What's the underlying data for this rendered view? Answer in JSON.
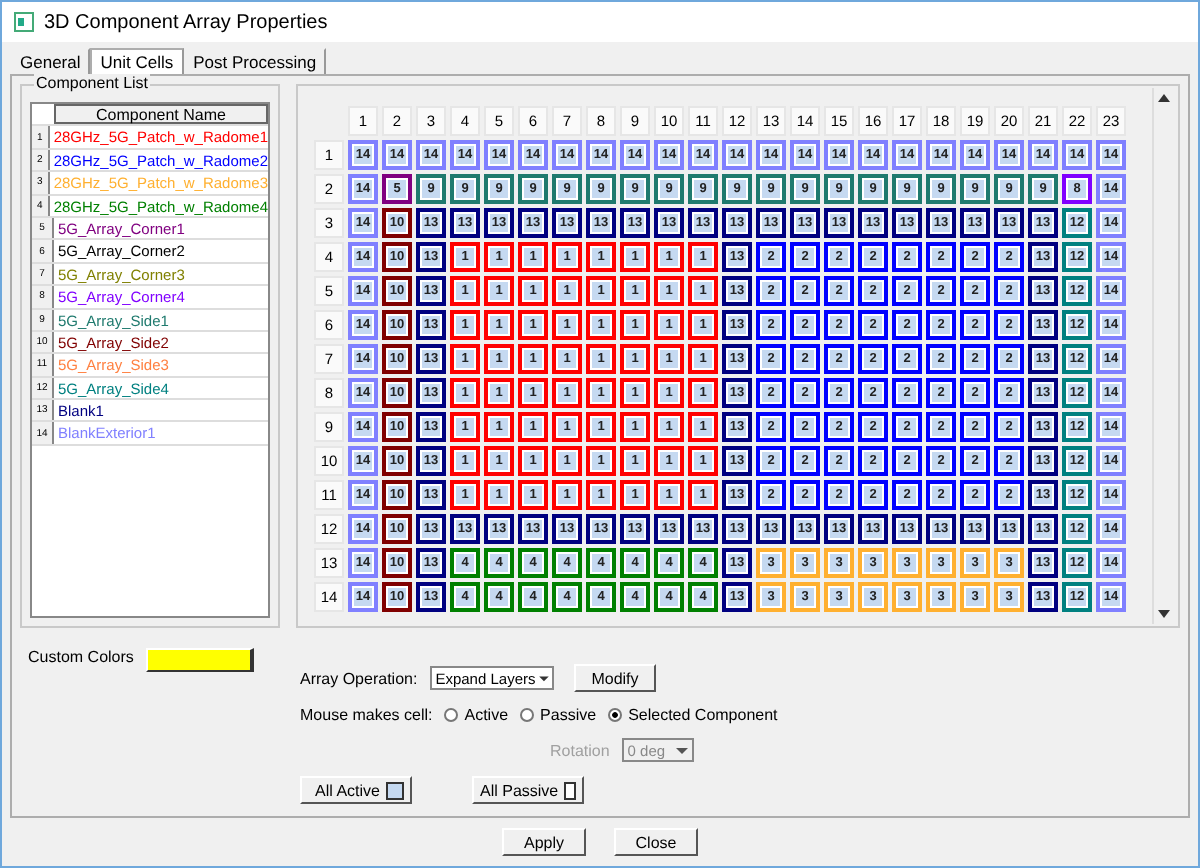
{
  "window": {
    "title": "3D Component Array Properties"
  },
  "tabs": [
    {
      "label": "General",
      "selected": false
    },
    {
      "label": "Unit Cells",
      "selected": true
    },
    {
      "label": "Post Processing",
      "selected": false
    }
  ],
  "component_list": {
    "title": "Component List",
    "column": "Component Name",
    "items": [
      {
        "index": "1",
        "name": "28GHz_5G_Patch_w_Radome1",
        "color": "#ff0000"
      },
      {
        "index": "2",
        "name": "28GHz_5G_Patch_w_Radome2",
        "color": "#0000ff"
      },
      {
        "index": "3",
        "name": "28GHz_5G_Patch_w_Radome3",
        "color": "#ffb030"
      },
      {
        "index": "4",
        "name": "28GHz_5G_Patch_w_Radome4",
        "color": "#008000"
      },
      {
        "index": "5",
        "name": "5G_Array_Corner1",
        "color": "#800080"
      },
      {
        "index": "6",
        "name": "5G_Array_Corner2",
        "color": "#000000"
      },
      {
        "index": "7",
        "name": "5G_Array_Corner3",
        "color": "#808000"
      },
      {
        "index": "8",
        "name": "5G_Array_Corner4",
        "color": "#8000ff"
      },
      {
        "index": "9",
        "name": "5G_Array_Side1",
        "color": "#1f7a6e"
      },
      {
        "index": "10",
        "name": "5G_Array_Side2",
        "color": "#800000"
      },
      {
        "index": "11",
        "name": "5G_Array_Side3",
        "color": "#ff8040"
      },
      {
        "index": "12",
        "name": "5G_Array_Side4",
        "color": "#008080"
      },
      {
        "index": "13",
        "name": "Blank1",
        "color": "#000080"
      },
      {
        "index": "14",
        "name": "BlankExterior1",
        "color": "#8080ff"
      }
    ]
  },
  "grid": {
    "columns": [
      "1",
      "2",
      "3",
      "4",
      "5",
      "6",
      "7",
      "8",
      "9",
      "10",
      "11",
      "12",
      "13",
      "14",
      "15",
      "16",
      "17",
      "18",
      "19",
      "20",
      "21",
      "22",
      "23"
    ],
    "rows": [
      {
        "label": "1",
        "cells": [
          "14",
          "14",
          "14",
          "14",
          "14",
          "14",
          "14",
          "14",
          "14",
          "14",
          "14",
          "14",
          "14",
          "14",
          "14",
          "14",
          "14",
          "14",
          "14",
          "14",
          "14",
          "14",
          "14"
        ]
      },
      {
        "label": "2",
        "cells": [
          "14",
          "5",
          "9",
          "9",
          "9",
          "9",
          "9",
          "9",
          "9",
          "9",
          "9",
          "9",
          "9",
          "9",
          "9",
          "9",
          "9",
          "9",
          "9",
          "9",
          "9",
          "8",
          "14"
        ]
      },
      {
        "label": "3",
        "cells": [
          "14",
          "10",
          "13",
          "13",
          "13",
          "13",
          "13",
          "13",
          "13",
          "13",
          "13",
          "13",
          "13",
          "13",
          "13",
          "13",
          "13",
          "13",
          "13",
          "13",
          "13",
          "12",
          "14"
        ]
      },
      {
        "label": "4",
        "cells": [
          "14",
          "10",
          "13",
          "1",
          "1",
          "1",
          "1",
          "1",
          "1",
          "1",
          "1",
          "13",
          "2",
          "2",
          "2",
          "2",
          "2",
          "2",
          "2",
          "2",
          "13",
          "12",
          "14"
        ]
      },
      {
        "label": "5",
        "cells": [
          "14",
          "10",
          "13",
          "1",
          "1",
          "1",
          "1",
          "1",
          "1",
          "1",
          "1",
          "13",
          "2",
          "2",
          "2",
          "2",
          "2",
          "2",
          "2",
          "2",
          "13",
          "12",
          "14"
        ]
      },
      {
        "label": "6",
        "cells": [
          "14",
          "10",
          "13",
          "1",
          "1",
          "1",
          "1",
          "1",
          "1",
          "1",
          "1",
          "13",
          "2",
          "2",
          "2",
          "2",
          "2",
          "2",
          "2",
          "2",
          "13",
          "12",
          "14"
        ]
      },
      {
        "label": "7",
        "cells": [
          "14",
          "10",
          "13",
          "1",
          "1",
          "1",
          "1",
          "1",
          "1",
          "1",
          "1",
          "13",
          "2",
          "2",
          "2",
          "2",
          "2",
          "2",
          "2",
          "2",
          "13",
          "12",
          "14"
        ]
      },
      {
        "label": "8",
        "cells": [
          "14",
          "10",
          "13",
          "1",
          "1",
          "1",
          "1",
          "1",
          "1",
          "1",
          "1",
          "13",
          "2",
          "2",
          "2",
          "2",
          "2",
          "2",
          "2",
          "2",
          "13",
          "12",
          "14"
        ]
      },
      {
        "label": "9",
        "cells": [
          "14",
          "10",
          "13",
          "1",
          "1",
          "1",
          "1",
          "1",
          "1",
          "1",
          "1",
          "13",
          "2",
          "2",
          "2",
          "2",
          "2",
          "2",
          "2",
          "2",
          "13",
          "12",
          "14"
        ]
      },
      {
        "label": "10",
        "cells": [
          "14",
          "10",
          "13",
          "1",
          "1",
          "1",
          "1",
          "1",
          "1",
          "1",
          "1",
          "13",
          "2",
          "2",
          "2",
          "2",
          "2",
          "2",
          "2",
          "2",
          "13",
          "12",
          "14"
        ]
      },
      {
        "label": "11",
        "cells": [
          "14",
          "10",
          "13",
          "1",
          "1",
          "1",
          "1",
          "1",
          "1",
          "1",
          "1",
          "13",
          "2",
          "2",
          "2",
          "2",
          "2",
          "2",
          "2",
          "2",
          "13",
          "12",
          "14"
        ]
      },
      {
        "label": "12",
        "cells": [
          "14",
          "10",
          "13",
          "13",
          "13",
          "13",
          "13",
          "13",
          "13",
          "13",
          "13",
          "13",
          "13",
          "13",
          "13",
          "13",
          "13",
          "13",
          "13",
          "13",
          "13",
          "12",
          "14"
        ]
      },
      {
        "label": "13",
        "cells": [
          "14",
          "10",
          "13",
          "4",
          "4",
          "4",
          "4",
          "4",
          "4",
          "4",
          "4",
          "13",
          "3",
          "3",
          "3",
          "3",
          "3",
          "3",
          "3",
          "3",
          "13",
          "12",
          "14"
        ]
      },
      {
        "label": "14",
        "cells": [
          "14",
          "10",
          "13",
          "4",
          "4",
          "4",
          "4",
          "4",
          "4",
          "4",
          "4",
          "13",
          "3",
          "3",
          "3",
          "3",
          "3",
          "3",
          "3",
          "3",
          "13",
          "12",
          "14"
        ]
      }
    ]
  },
  "custom_colors": {
    "label": "Custom Colors",
    "color": "#ffff00"
  },
  "array_operation": {
    "label": "Array Operation:",
    "value": "Expand Layers",
    "button": "Modify"
  },
  "mouse_makes_cell": {
    "label": "Mouse makes cell:",
    "options": [
      {
        "label": "Active",
        "selected": false
      },
      {
        "label": "Passive",
        "selected": false
      },
      {
        "label": "Selected Component",
        "selected": true
      }
    ]
  },
  "rotation": {
    "label": "Rotation",
    "value": "0 deg",
    "disabled": true
  },
  "all_buttons": [
    {
      "label": "All Active",
      "kind": "active"
    },
    {
      "label": "All Passive",
      "kind": "passive"
    }
  ],
  "footer_buttons": [
    "Apply",
    "Close"
  ]
}
